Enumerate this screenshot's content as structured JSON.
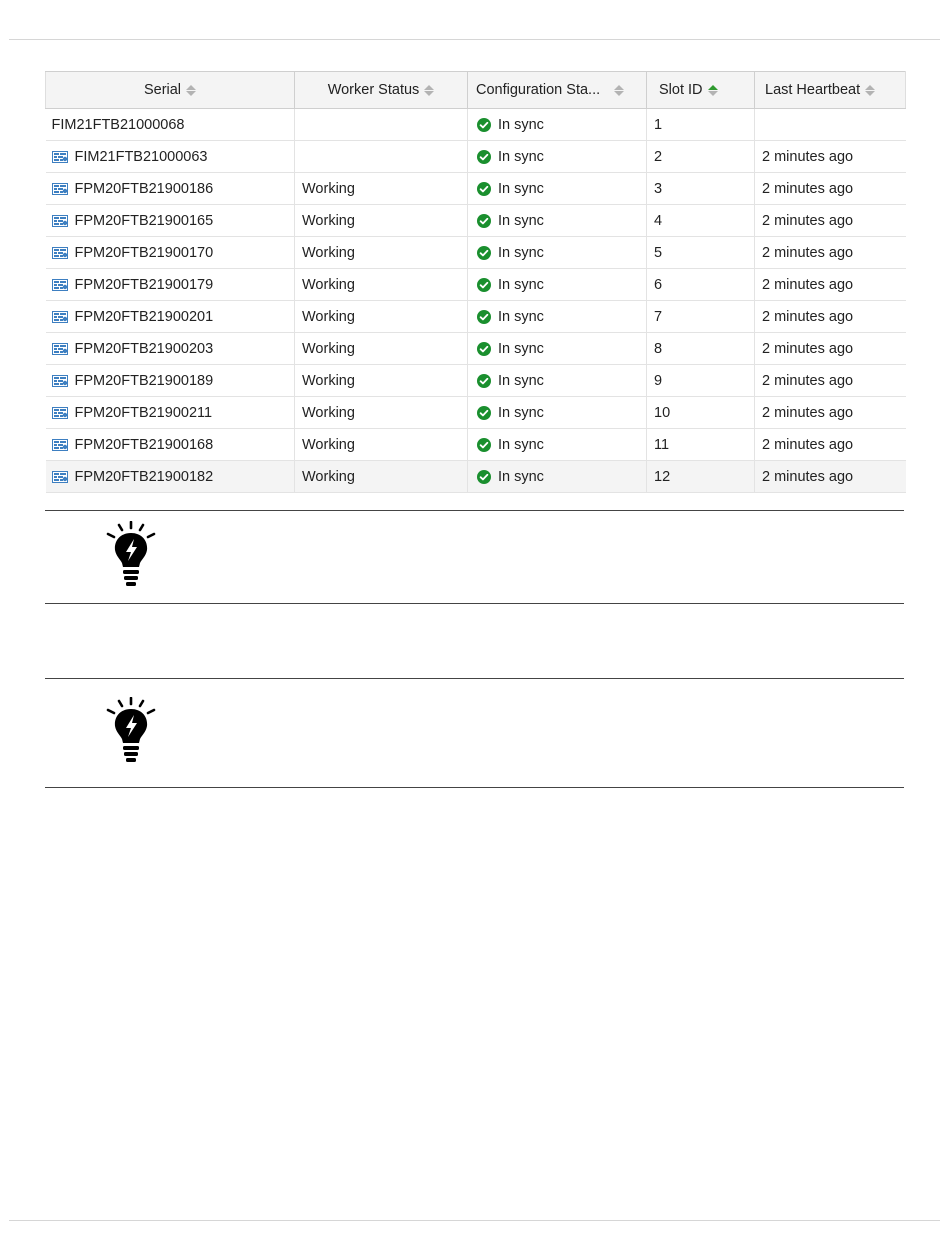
{
  "table": {
    "columns": [
      {
        "label": "Serial",
        "sort": "none"
      },
      {
        "label": "Worker Status",
        "sort": "none"
      },
      {
        "label": "Configuration Sta...",
        "sort": "none"
      },
      {
        "label": "Slot ID",
        "sort": "asc"
      },
      {
        "label": "Last Heartbeat",
        "sort": "none"
      }
    ],
    "rows": [
      {
        "serial": "FIM21FTB21000068",
        "worker_status": "",
        "config_status": "In sync",
        "slot_id": "1",
        "last_heartbeat": ""
      },
      {
        "serial": "FIM21FTB21000063",
        "worker_status": "",
        "config_status": "In sync",
        "slot_id": "2",
        "last_heartbeat": "2 minutes ago"
      },
      {
        "serial": "FPM20FTB21900186",
        "worker_status": "Working",
        "config_status": "In sync",
        "slot_id": "3",
        "last_heartbeat": "2 minutes ago"
      },
      {
        "serial": "FPM20FTB21900165",
        "worker_status": "Working",
        "config_status": "In sync",
        "slot_id": "4",
        "last_heartbeat": "2 minutes ago"
      },
      {
        "serial": "FPM20FTB21900170",
        "worker_status": "Working",
        "config_status": "In sync",
        "slot_id": "5",
        "last_heartbeat": "2 minutes ago"
      },
      {
        "serial": "FPM20FTB21900179",
        "worker_status": "Working",
        "config_status": "In sync",
        "slot_id": "6",
        "last_heartbeat": "2 minutes ago"
      },
      {
        "serial": "FPM20FTB21900201",
        "worker_status": "Working",
        "config_status": "In sync",
        "slot_id": "7",
        "last_heartbeat": "2 minutes ago"
      },
      {
        "serial": "FPM20FTB21900203",
        "worker_status": "Working",
        "config_status": "In sync",
        "slot_id": "8",
        "last_heartbeat": "2 minutes ago"
      },
      {
        "serial": "FPM20FTB21900189",
        "worker_status": "Working",
        "config_status": "In sync",
        "slot_id": "9",
        "last_heartbeat": "2 minutes ago"
      },
      {
        "serial": "FPM20FTB21900211",
        "worker_status": "Working",
        "config_status": "In sync",
        "slot_id": "10",
        "last_heartbeat": "2 minutes ago"
      },
      {
        "serial": "FPM20FTB21900168",
        "worker_status": "Working",
        "config_status": "In sync",
        "slot_id": "11",
        "last_heartbeat": "2 minutes ago"
      },
      {
        "serial": "FPM20FTB21900182",
        "worker_status": "Working",
        "config_status": "In sync",
        "slot_id": "12",
        "last_heartbeat": "2 minutes ago"
      }
    ]
  },
  "icons": {
    "device": "fortigate-device-icon",
    "status_ok": "check-circle-icon",
    "sort": "sort-arrows-icon",
    "tip": "lightbulb-icon"
  },
  "colors": {
    "status_ok": "#1a8f2e",
    "sort_active": "#2f9a2f",
    "device_icon": "#3d7fc1"
  }
}
